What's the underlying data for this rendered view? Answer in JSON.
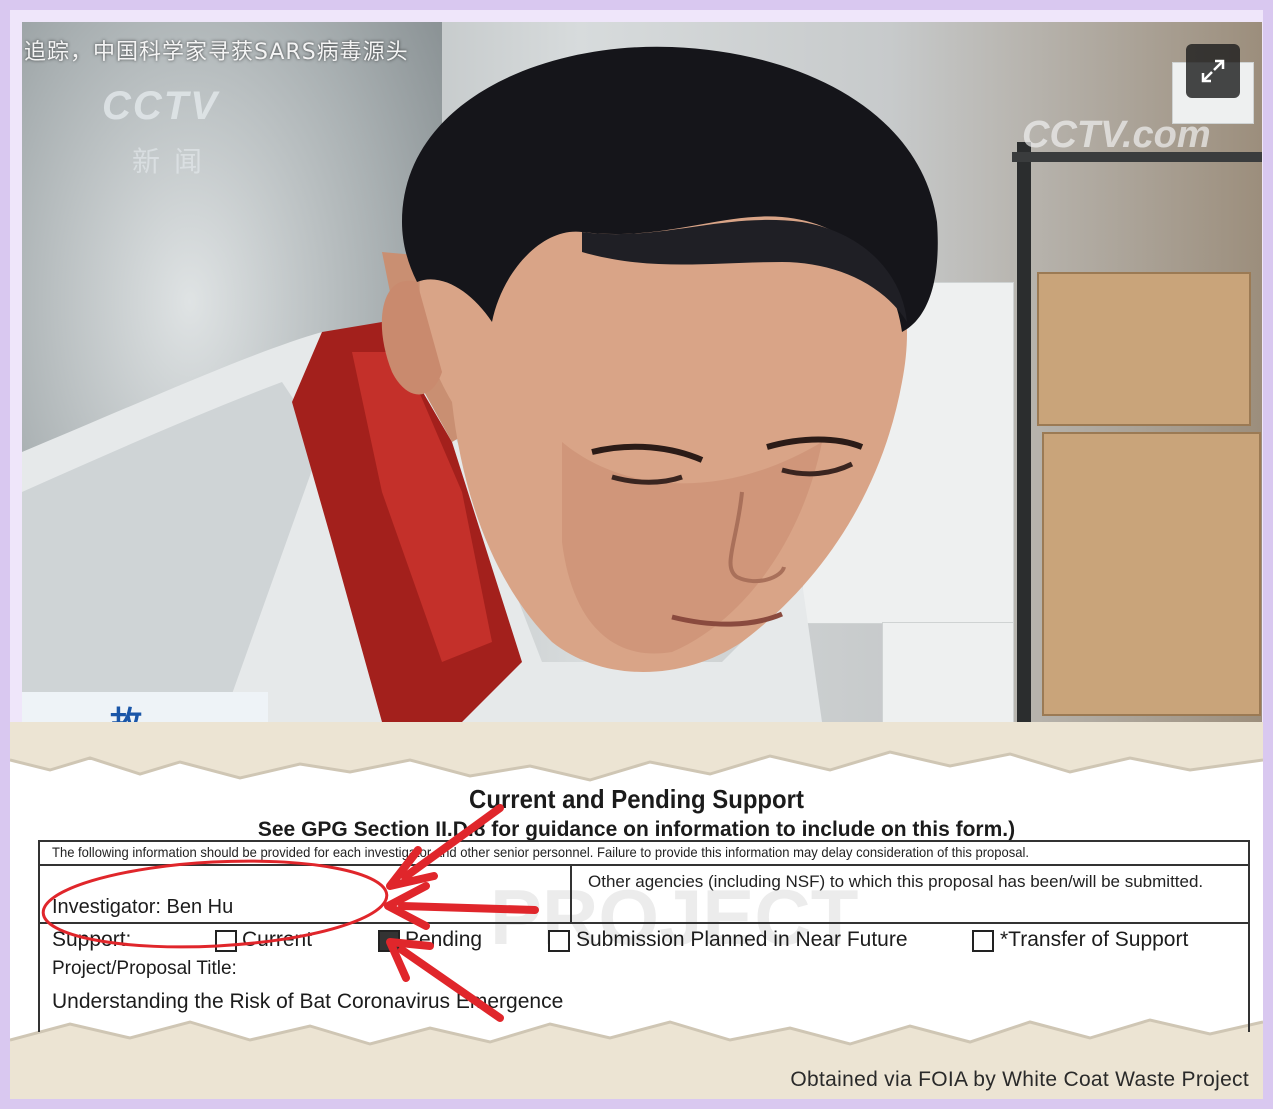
{
  "video": {
    "caption": "追踪，中国科学家寻获SARS病毒源头",
    "logo_left": "CCTV",
    "logo_left_sub": "新闻",
    "logo_right": "CCTV.com",
    "chyron": "故事",
    "expand_icon": "expand-arrows-icon"
  },
  "document": {
    "title": "Current and Pending Support",
    "subtitle": "See GPG Section II.D.8 for guidance on information to include on this form.)",
    "instructions": "The following information should be provided for each investigator and other senior personnel.  Failure to provide this information may delay consideration of this proposal.",
    "investigator": "Investigator: Ben Hu",
    "other_agencies": "Other agencies (including NSF) to which this proposal has been/will be submitted.",
    "support_label": "Support:",
    "options": {
      "current": "Current",
      "pending": "Pending",
      "planned": "Submission Planned in Near Future",
      "transfer": "*Transfer of Support"
    },
    "project_label": "Project/Proposal Title:",
    "project_title": "Understanding the Risk of Bat Coronavirus Emergence",
    "watermark": "PROJECT",
    "credit": "Obtained via FOIA by White Coat Waste Project"
  },
  "colors": {
    "frame": "#d9c8f0",
    "annotation_red": "#e0262b",
    "chyron_text": "#1a56a8"
  }
}
